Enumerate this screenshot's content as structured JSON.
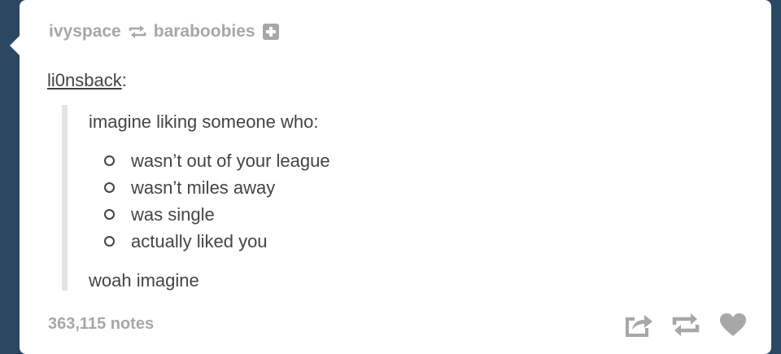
{
  "post": {
    "reblogger": "ivyspace",
    "reblogged_from": "baraboobies",
    "source_user": "li0nsback",
    "source_suffix": ":",
    "quote": {
      "intro": "imagine liking someone who:",
      "items": [
        "wasn’t out of your league",
        "wasn’t miles away",
        "was single",
        "actually liked you"
      ],
      "outro": "woah imagine"
    },
    "notes": "363,115 notes"
  },
  "colors": {
    "background": "#2c4762",
    "card": "#ffffff",
    "muted": "#a7a7a7",
    "text": "#444444",
    "quote_border": "#e3e3e3"
  },
  "icons": {
    "reblog": "reblog-icon",
    "follow": "follow-plus-icon",
    "share": "share-icon",
    "heart": "heart-icon"
  }
}
